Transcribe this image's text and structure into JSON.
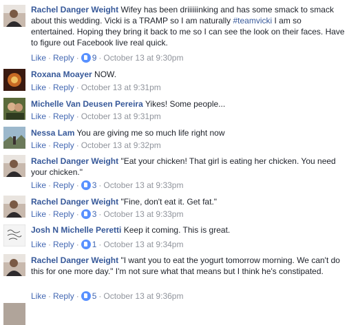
{
  "actions": {
    "like": "Like",
    "reply": "Reply",
    "dot": "·"
  },
  "comments": [
    {
      "author": "Rachel Danger Weight",
      "text_before": "Wifey has been driiiiiinking and has some smack to smack about this wedding. Vicki is a TRAMP so I am naturally ",
      "tag": "#teamvicki",
      "text_after": " I am so entertained. Hoping they bring it back to me so I can see the look on their faces. Have to figure out Facebook live real quick.",
      "reactions": "9",
      "time": "October 13 at 9:30pm"
    },
    {
      "author": "Roxana Moayer",
      "text_before": "NOW.",
      "reactions": "",
      "time": "October 13 at 9:31pm"
    },
    {
      "author": "Michelle Van Deusen Pereira",
      "text_before": "Yikes! Some people...",
      "reactions": "",
      "time": "October 13 at 9:31pm"
    },
    {
      "author": "Nessa Lam",
      "text_before": "You are giving me so much life right now",
      "reactions": "",
      "time": "October 13 at 9:32pm"
    },
    {
      "author": "Rachel Danger Weight",
      "text_before": "\"Eat your chicken! That girl is eating her chicken. You need your chicken.\"",
      "reactions": "3",
      "time": "October 13 at 9:33pm"
    },
    {
      "author": "Rachel Danger Weight",
      "text_before": "\"Fine, don't eat it. Get fat.\"",
      "reactions": "3",
      "time": "October 13 at 9:33pm"
    },
    {
      "author": "Josh N Michelle Peretti",
      "text_before": "Keep it coming. This is great.",
      "reactions": "1",
      "time": "October 13 at 9:34pm"
    },
    {
      "author": "Rachel Danger Weight",
      "text_before": "\"I want you to eat the yogurt tomorrow morning. We can't do this for one more day.\" I'm not sure what that means but I think he's constipated.",
      "reactions": "5",
      "time": "October 13 at 9:36pm"
    }
  ]
}
